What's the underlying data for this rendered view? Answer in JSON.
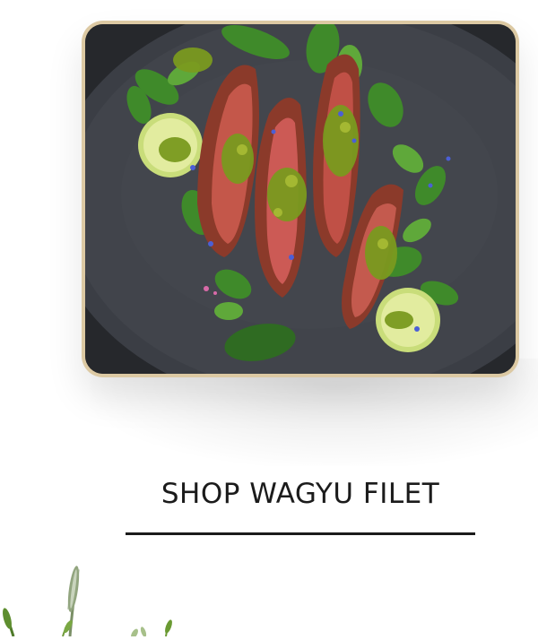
{
  "product_card": {
    "image_alt": "Sliced grilled wagyu steak with chimichurri, greens and lime on a dark plate"
  },
  "cta": {
    "label": "SHOP WAGYU FILET"
  },
  "colors": {
    "card_frame": "#dcc9a3",
    "text": "#1b1b1b",
    "plate": "#3a3d44"
  }
}
